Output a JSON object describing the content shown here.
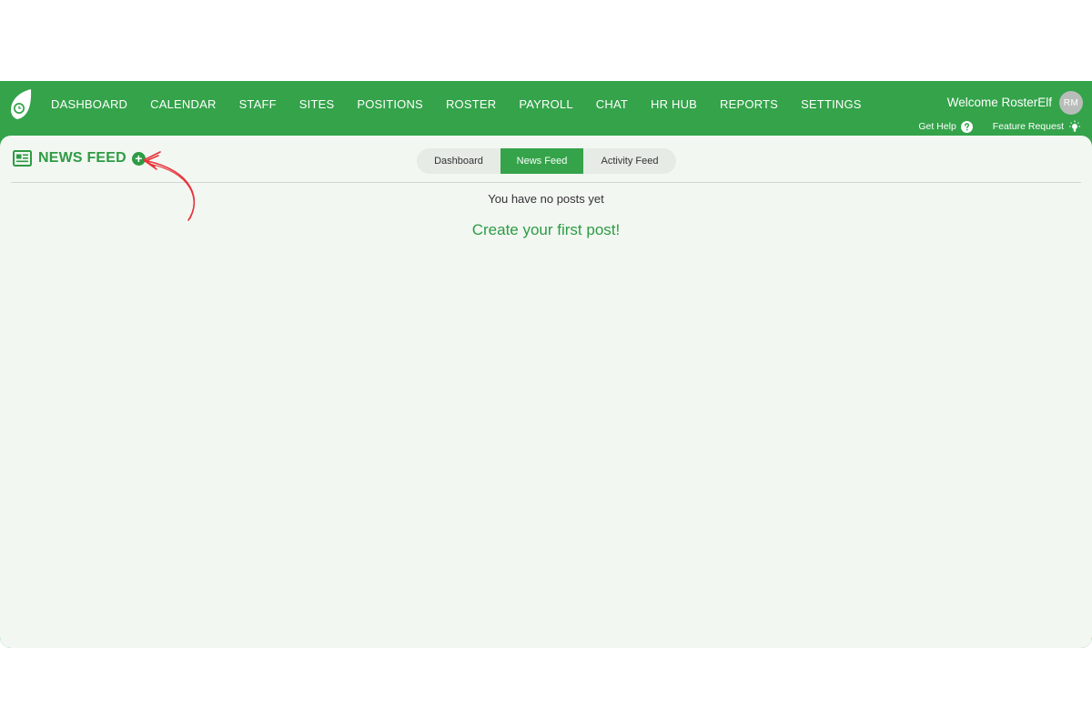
{
  "header": {
    "nav": [
      {
        "id": "dashboard",
        "label": "DASHBOARD"
      },
      {
        "id": "calendar",
        "label": "CALENDAR"
      },
      {
        "id": "staff",
        "label": "STAFF"
      },
      {
        "id": "sites",
        "label": "SITES"
      },
      {
        "id": "positions",
        "label": "POSITIONS"
      },
      {
        "id": "roster",
        "label": "ROSTER"
      },
      {
        "id": "payroll",
        "label": "PAYROLL"
      },
      {
        "id": "chat",
        "label": "CHAT"
      },
      {
        "id": "hrhub",
        "label": "HR HUB"
      },
      {
        "id": "reports",
        "label": "REPORTS"
      },
      {
        "id": "settings",
        "label": "SETTINGS"
      }
    ],
    "welcome": "Welcome RosterElf",
    "avatar_initials": "RM",
    "get_help": "Get Help",
    "feature_request": "Feature Request"
  },
  "page": {
    "title": "NEWS FEED",
    "tabs": [
      "Dashboard",
      "News Feed",
      "Activity Feed"
    ],
    "active_tab": "News Feed",
    "empty_message": "You have no posts yet",
    "create_link": "Create your first post!"
  },
  "colors": {
    "brand_green": "#34a34a",
    "content_bg": "#f2f7f2",
    "annotation_arrow": "#e8323a"
  },
  "icons": {
    "logo": "leaf-clock-icon",
    "title": "newspaper-icon",
    "add": "plus-circle-icon",
    "help": "question-circle-icon",
    "feature": "lightbulb-icon",
    "annotation": "red-arrow-icon"
  }
}
